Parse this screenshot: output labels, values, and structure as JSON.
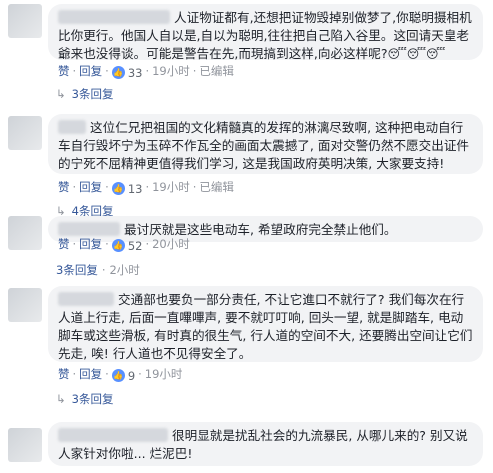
{
  "labels": {
    "like": "赞",
    "reply": "回复",
    "separator": "·",
    "edited": "已编辑",
    "reply_arrow": "↳"
  },
  "comments": [
    {
      "text": "人证物证都有,还想把证物毁掉别做梦了,你聪明摄相机比你更行。他国人自以是,自以为聪明,往往把自己陷入谷里。这回请天皇老爺来也没得谈。可能是警告在先,而現搞到这样,向必这样呢?",
      "emoji": "😴😴😴",
      "likes": "33",
      "time": "19小时",
      "edited": true,
      "reply_count": "3条回复"
    },
    {
      "text": "这位仁兄把祖国的文化精髓真的发挥的淋漓尽致啊, 这种把电动自行车自行毁坏宁为玉碎不作瓦全的画面太震撼了, 面对交警仍然不愿交出证件的宁死不屈精神更值得我们学习, 这是我国政府英明决策, 大家要支持!",
      "likes": "13",
      "time": "19小时",
      "edited": true,
      "reply_count": "4条回复"
    },
    {
      "text": "最讨厌就是这些电动车, 希望政府完全禁止他们。",
      "likes": "52",
      "time": "20小时",
      "edited": false,
      "reply_count": "3条回复",
      "reply_time": "2小时"
    },
    {
      "text": "交通部也要负一部分责任, 不让它進口不就行了? 我们每次在行人道上行走, 后面一直嗶嗶声, 要不就叮叮响, 回头一望, 就是脚踏车, 电动脚车或这些滑板, 有时真的很生气, 行人道的空间不大, 还要腾出空间让它们先走, 唉! 行人道也不见得安全了。",
      "likes": "9",
      "time": "19小时",
      "edited": false,
      "reply_count": "3条回复"
    },
    {
      "text": "很明显就是扰乱社会的九流暴民, 从哪儿来的? 别又说人家针对你啦... 烂泥巴!",
      "edited": false
    }
  ]
}
